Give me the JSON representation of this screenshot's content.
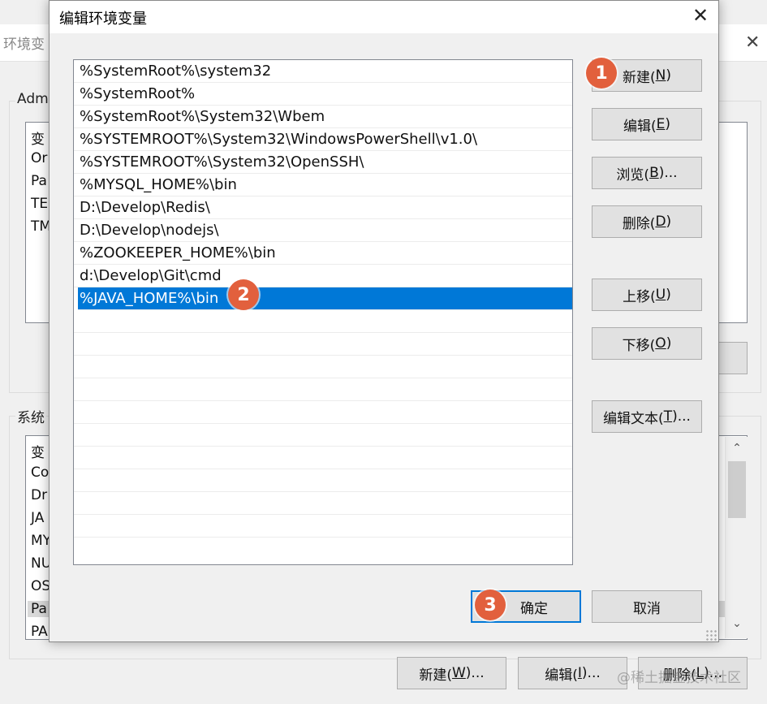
{
  "background_window": {
    "title": "环境变",
    "user_group_label": "Adm",
    "user_list": [
      "变",
      "Or",
      "Pa",
      "TE",
      "TM"
    ],
    "system_group_label": "系统",
    "system_list": [
      "变",
      "Co",
      "Dr",
      "JA",
      "MY",
      "NU",
      "OS",
      "Pa",
      "PA"
    ],
    "buttons": {
      "new_prefix": "新建(",
      "new_key": "W",
      "new_suffix": ")...",
      "edit_prefix": "编辑(",
      "edit_key": "I",
      "edit_suffix": ")...",
      "delete_prefix": "删除(",
      "delete_key": "L",
      "delete_suffix": ")..."
    },
    "watermark": "@稀土掘金技术社区"
  },
  "dialog": {
    "title": "编辑环境变量",
    "paths": [
      "%SystemRoot%\\system32",
      "%SystemRoot%",
      "%SystemRoot%\\System32\\Wbem",
      "%SYSTEMROOT%\\System32\\WindowsPowerShell\\v1.0\\",
      "%SYSTEMROOT%\\System32\\OpenSSH\\",
      "%MYSQL_HOME%\\bin",
      "D:\\Develop\\Redis\\",
      "D:\\Develop\\nodejs\\",
      "%ZOOKEEPER_HOME%\\bin",
      "d:\\Develop\\Git\\cmd",
      "%JAVA_HOME%\\bin"
    ],
    "selected_index": 10,
    "buttons": {
      "new": {
        "prefix": "新建(",
        "key": "N",
        "suffix": ")"
      },
      "edit": {
        "prefix": "编辑(",
        "key": "E",
        "suffix": ")"
      },
      "browse": {
        "prefix": "浏览(",
        "key": "B",
        "suffix": ")..."
      },
      "delete": {
        "prefix": "删除(",
        "key": "D",
        "suffix": ")"
      },
      "move_up": {
        "prefix": "上移(",
        "key": "U",
        "suffix": ")"
      },
      "move_down": {
        "prefix": "下移(",
        "key": "O",
        "suffix": ")"
      },
      "edit_text": {
        "prefix": "编辑文本(",
        "key": "T",
        "suffix": ")..."
      }
    },
    "ok_label": "确定",
    "cancel_label": "取消"
  },
  "badges": [
    "1",
    "2",
    "3"
  ],
  "colors": {
    "selection": "#0078d7",
    "badge": "#e2603d",
    "button_face": "#e1e1e1",
    "dialog_bg": "#f0f0f0"
  },
  "icons": {
    "close": "close-icon",
    "scroll_up": "chevron-up-icon",
    "scroll_down": "chevron-down-icon",
    "resize": "resize-grip-icon"
  }
}
